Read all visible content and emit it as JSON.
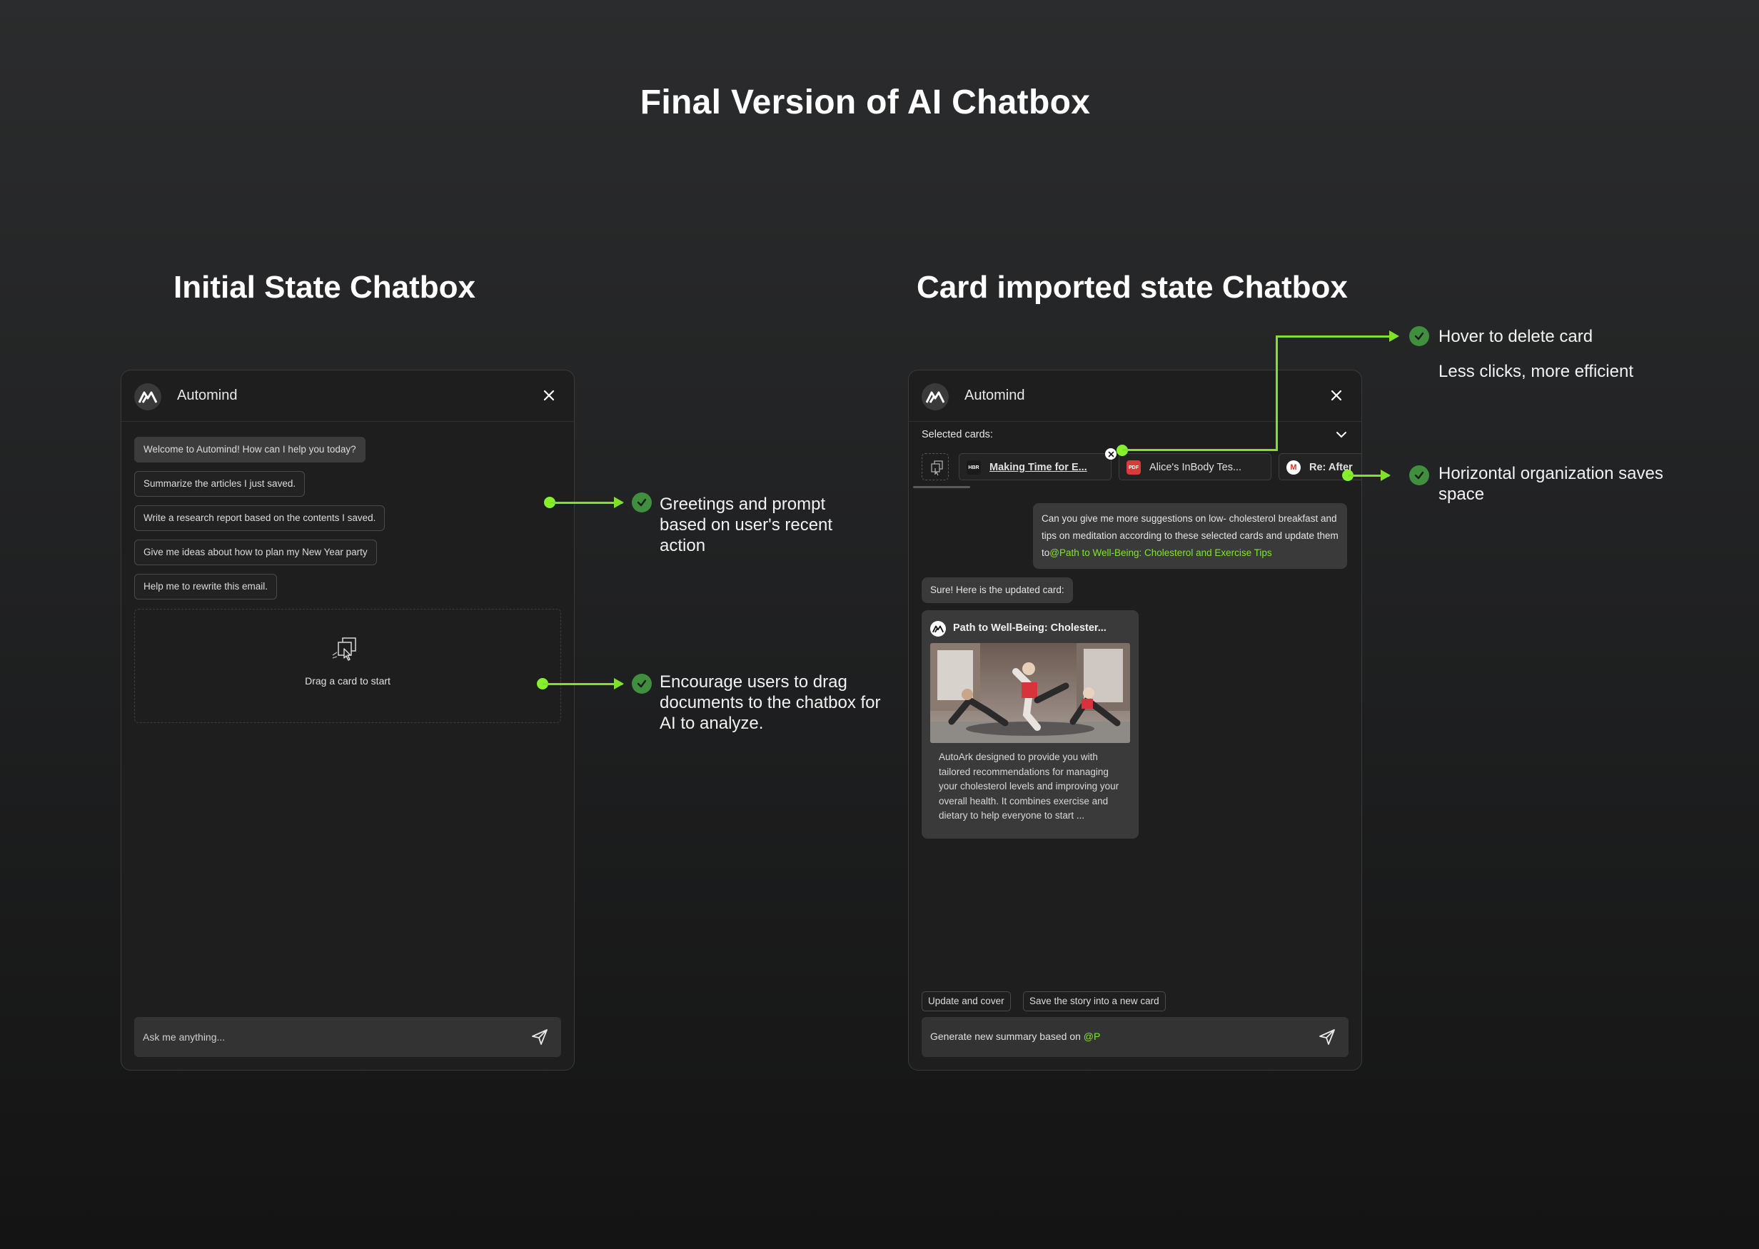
{
  "page": {
    "title": "Final Version of AI Chatbox"
  },
  "left": {
    "section_title": "Initial State Chatbox",
    "app_name": "Automind",
    "prompts": [
      "Welcome to Automind! How can I help you today?",
      "Summarize the articles I just saved.",
      "Write a research report based on the contents I saved.",
      "Give me ideas about how to plan my New Year party",
      "Help me to rewrite this email."
    ],
    "dropzone_label": "Drag a card to start",
    "input_placeholder": "Ask me anything..."
  },
  "right": {
    "section_title": "Card imported state Chatbox",
    "app_name": "Automind",
    "selected_label": "Selected cards:",
    "cards": [
      {
        "tag": "HBR",
        "label": "Making Time for E..."
      },
      {
        "tag": "PDF",
        "label": "Alice's InBody Tes..."
      },
      {
        "tag": "M",
        "label": "Re: After"
      }
    ],
    "user_message": "Can you give me more suggestions on low- cholesterol breakfast and tips on meditation according to these selected cards and update them to",
    "user_mention": "@Path to Well-Being: Cholesterol and Exercise Tips",
    "ai_message": "Sure! Here is the updated card:",
    "result_card": {
      "title": "Path to Well-Being: Cholester...",
      "description": "AutoArk designed to provide you with tailored recommendations for managing your cholesterol levels and improving your overall health. It combines exercise and dietary to help everyone to start ..."
    },
    "actions": [
      "Update and cover",
      "Save the story into a new card"
    ],
    "input_text": "Generate new summary based on",
    "input_mention": "@P"
  },
  "annotations": {
    "greetings": "Greetings and prompt based on user's recent action",
    "encourage": "Encourage users to drag documents to the chatbox for AI to analyze.",
    "hover_delete": "Hover to delete card",
    "less_clicks": "Less clicks, more efficient",
    "horizontal": "Horizontal organization saves space"
  },
  "colors": {
    "accent": "#7fe12a",
    "check": "#3f8f3f",
    "panel": "#1e1e1e"
  }
}
